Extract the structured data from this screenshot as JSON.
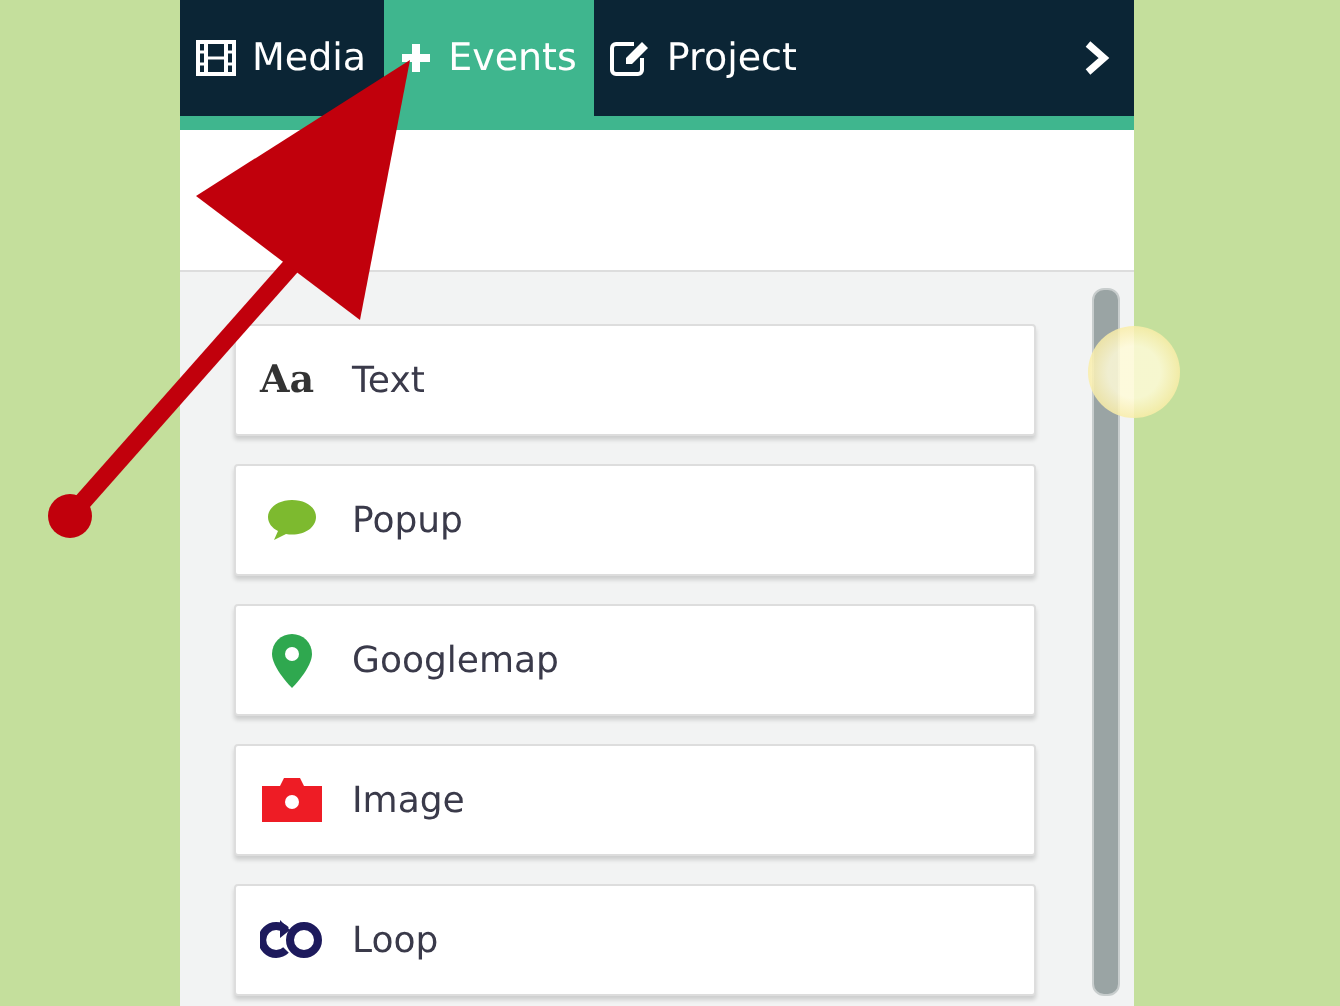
{
  "tabs": [
    {
      "label": "Media",
      "kind": "film",
      "selected": false
    },
    {
      "label": "Events",
      "kind": "plus",
      "selected": true
    },
    {
      "label": "Project",
      "kind": "edit",
      "selected": false
    }
  ],
  "events": [
    {
      "label": "Text",
      "kind": "text",
      "glyph": "Aa"
    },
    {
      "label": "Popup",
      "kind": "popup"
    },
    {
      "label": "Googlemap",
      "kind": "map"
    },
    {
      "label": "Image",
      "kind": "image"
    },
    {
      "label": "Loop",
      "kind": "loop"
    }
  ]
}
